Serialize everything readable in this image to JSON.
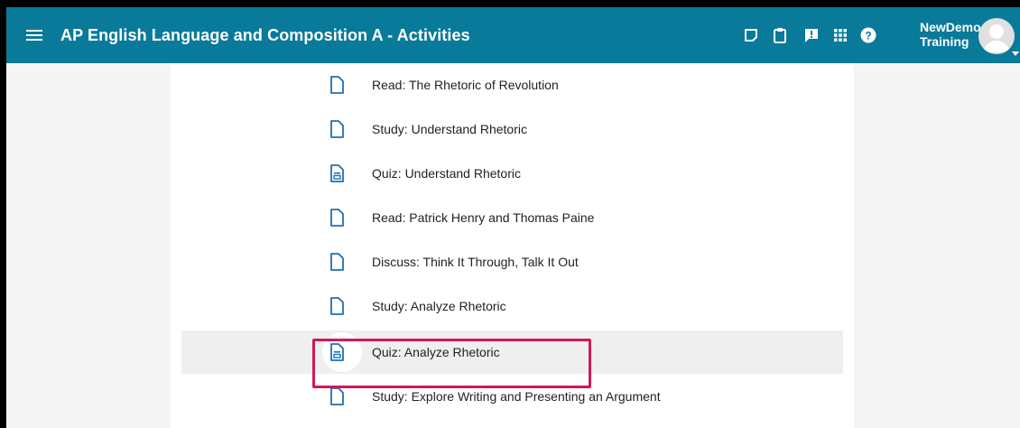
{
  "header": {
    "title": "AP English Language and Composition A - Activities",
    "icons": [
      "menu-icon",
      "sticky-note-icon",
      "clipboard-icon",
      "feedback-icon",
      "apps-grid-icon",
      "help-icon"
    ],
    "user_line1": "NewDemo",
    "user_line2": "Training",
    "bar_color": "#0a7a9b"
  },
  "activities": [
    {
      "label": "Read: The Rhetoric of Revolution",
      "icon": "document-icon"
    },
    {
      "label": "Study: Understand Rhetoric",
      "icon": "document-icon"
    },
    {
      "label": "Quiz: Understand Rhetoric",
      "icon": "quiz-icon"
    },
    {
      "label": "Read: Patrick Henry and Thomas Paine",
      "icon": "document-icon"
    },
    {
      "label": "Discuss: Think It Through, Talk It Out",
      "icon": "document-icon"
    },
    {
      "label": "Study: Analyze Rhetoric",
      "icon": "document-icon"
    },
    {
      "label": "Quiz: Analyze Rhetoric",
      "icon": "quiz-icon",
      "selected": true
    },
    {
      "label": "Study: Explore Writing and Presenting an Argument",
      "icon": "document-icon"
    }
  ],
  "highlight_color": "#d3175a",
  "icon_color": "#1f6fb5"
}
